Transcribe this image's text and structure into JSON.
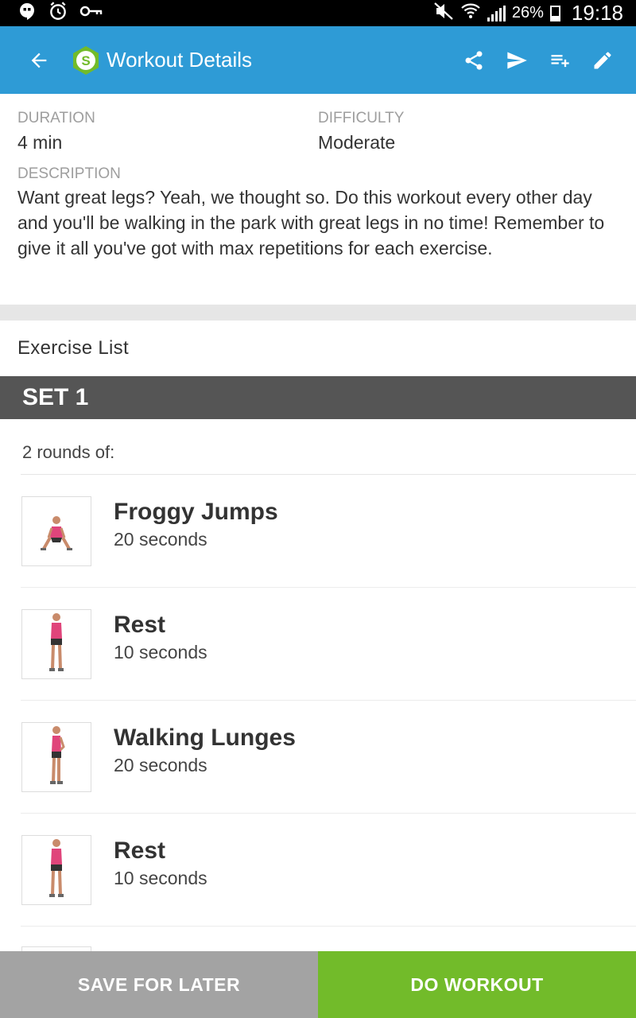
{
  "status_bar": {
    "battery": "26%",
    "time": "19:18",
    "icons": [
      "hangouts-icon",
      "alarm-icon",
      "vpn-key-icon",
      "mute-icon",
      "wifi-icon",
      "signal-icon",
      "battery-icon"
    ]
  },
  "app_bar": {
    "title": "Workout Details",
    "icons": [
      "back-arrow-icon",
      "app-logo-icon",
      "share-icon",
      "send-icon",
      "playlist-add-icon",
      "edit-icon"
    ],
    "color": "#2e9bd6"
  },
  "details": {
    "duration_label": "DURATION",
    "duration_value": "4 min",
    "difficulty_label": "DIFFICULTY",
    "difficulty_value": "Moderate",
    "description_label": "DESCRIPTION",
    "description": "Want great legs? Yeah, we thought so. Do this workout every other day and you'll be walking in the park with great legs in no time! Remember to give it all you've got with max repetitions for each exercise."
  },
  "exercise_list_title": "Exercise List",
  "set": {
    "title": "SET 1",
    "rounds": "2 rounds of:"
  },
  "exercises": [
    {
      "name": "Froggy Jumps",
      "duration": "20 seconds"
    },
    {
      "name": "Rest",
      "duration": "10 seconds"
    },
    {
      "name": "Walking Lunges",
      "duration": "20 seconds"
    },
    {
      "name": "Rest",
      "duration": "10 seconds"
    }
  ],
  "bottom": {
    "save_label": "SAVE FOR LATER",
    "do_label": "DO WORKOUT"
  },
  "colors": {
    "accent": "#2e9bd6",
    "go": "#72bb2a",
    "save": "#a3a3a3",
    "set_header": "#555555"
  }
}
